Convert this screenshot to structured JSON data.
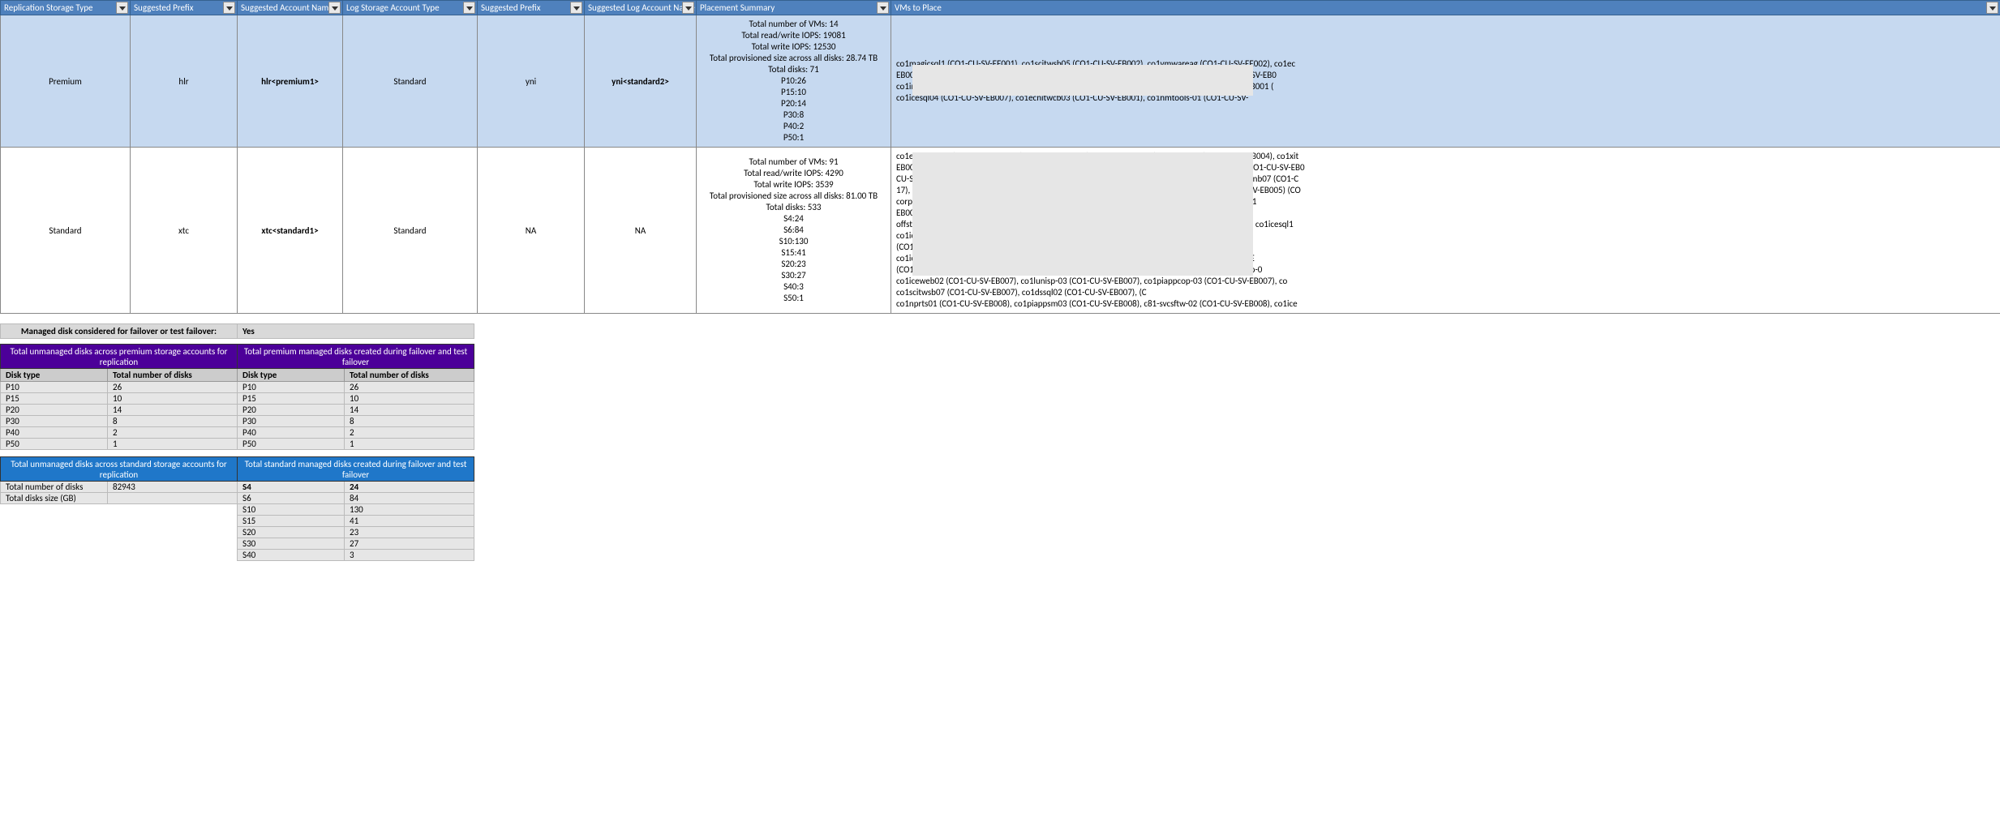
{
  "headers": {
    "c0": "Replication Storage Type",
    "c1": "Suggested Prefix",
    "c2": "Suggested Account Name",
    "c3": "Log Storage Account Type",
    "c4": "Suggested Prefix",
    "c5": "Suggested Log Account  Name",
    "c6": "Placement Summary",
    "c7": "VMs to Place"
  },
  "rows": [
    {
      "repl_type": "Premium",
      "prefix": "hlr",
      "account": "hlr<premium1>",
      "log_type": "Standard",
      "log_prefix": "yni",
      "log_account": "yni<standard2>",
      "summary": "Total number of VMs: 14\nTotal read/write IOPS: 19081\nTotal write IOPS: 12530\nTotal provisioned size across all disks: 28.74 TB\nTotal disks: 71\nP10:26\nP15:10\nP20:14\nP30:8\nP40:2\nP50:1",
      "vms": "co1magicsql1 (CO1-CU-SV-EE001), co1scitwsb05 (CO1-CU-SV-EB002), co1vmwareag (CO1-CU-SV-EE002), co1ec\nEB003), co1mpsdb01 (CO1-CU-SV-EE005), co1datamg01 (CO1-CU-SV-EB004), co1dssql01 (CO1-CU-SV-EB0\nco1intsvc02 (CO1-CU-SV-EB005), co1ecnintweb02 (CO1-CU-SV-EB007), co1lunisp-02 (CO1-CU-SV-EB001 (\nco1icesql04 (CO1-CU-SV-EB007), co1ecnitwcb03 (CO1-CU-SV-EB001), co1nmtools-01 (CO1-CU-SV-"
    },
    {
      "repl_type": "Standard",
      "prefix": "xtc",
      "account": "xtc<standard1>",
      "log_type": "Standard",
      "log_prefix": "NA",
      "log_account": "NA",
      "summary": "Total number of VMs: 91\nTotal read/write IOPS: 4290\nTotal write IOPS: 3539\nTotal provisioned size across all disks: 81.00 TB\nTotal disks: 533\nS4:24\nS6:84\nS10:130\nS15:41\nS20:23\nS30:27\nS40:3\nS50:1",
      "vms": "co1ecritwnb07 (CO1-CU-SV-EB004), co1piappcrm02 (CO1-CU-SV-EB004), co1cu1407 (CO1-CU-SV-EB004), co1xit\nEB004), co1ecnintweb02 (CO1-CU-SV-EB004), co1nmstatm-01 (CO1-CU-SV-EB004), co1intweb01 (CO1-CU-SV-EB0\nCU-SV-EB004), co1ecnitwcb03 (CO1-CU-SV-EB005), co1piappcop-01 (CO1-CU-SV-EB005), co1ecritwnb07 (CO1-C\n17), co1iceweb01 (CO1-CU-SV-EB005), co1nprts02 (CO1-CU-SV-EB005), co1piappdxp-01 (CO1-CU-SV-EB005) (CO\ncorp-02 (CO1-CU-SV-EB005), co1mpsivr03 (CO1-CU-SV-EB005), co1icesql01 (CO1-CU-SV-EB005). co1\nEB005). co1dataci01 (CO1-CU-SV-EB005), co1ecnitweb01 (CO1-CU-SV-EB005), co1sftp-01 (CO1-C\noffstg01 (CO1-CU-SV-EB005), co1ecnitecd02 (CO1-CU-SV-EB005), co1mpsivr04 (CO1-CU-SV-EB005), co1icesql1\nco1icesql03 (CO1-CU-SV-EB005), co1iceapp01 (CO1-CU-SV-EB005), co1icesql02 (CO1-CU-SV-EB006)\n(CO1-CU-SV-EB006), co1dbweb01 (CO1-CU-SV-EB006), co1scitwsb03 (CO1-CU-SV-EB006) (CO\nco1iceweb01 (CO1-CU-SV-EB006), co1iceapp02 (CO1-CU-SV-EB006), co1ecnitcem01 (CO1-CU-SV-EE\n(CO1-CU-SV-EB007), co1fp-03 (CO1-CU-SV-EB007), co1piappivr04 (CO1-CU-SV-EB007), co1piappdxp-0\nco1iceweb02 (CO1-CU-SV-EB007), co1lunisp-03 (CO1-CU-SV-EB007), co1piappcop-03 (CO1-CU-SV-EB007), co\nco1scitwsb07 (CO1-CU-SV-EB007), co1dssql02 (CO1-CU-SV-EB007), (C\nco1nprts01 (CO1-CU-SV-EB008), co1piappsm03 (CO1-CU-SV-EB008), c81-svcsftw-02 (CO1-CU-SV-EB008), co1ice"
    }
  ],
  "managed_label": "Managed disk considered for failover or test failover:",
  "managed_value": "Yes",
  "premium": {
    "left_title": "Total  unmanaged disks across premium storage accounts for replication",
    "right_title": "Total premium managed disks created during failover and test failover",
    "sub_disk": "Disk type",
    "sub_total": "Total number of disks",
    "rows": [
      {
        "k": "P10",
        "v": "26"
      },
      {
        "k": "P15",
        "v": "10"
      },
      {
        "k": "P20",
        "v": "14"
      },
      {
        "k": "P30",
        "v": "8"
      },
      {
        "k": "P40",
        "v": "2"
      },
      {
        "k": "P50",
        "v": "1"
      }
    ]
  },
  "standard": {
    "left_title": "Total unmanaged disks across standard storage accounts for replication",
    "right_title": "Total standard managed disks created during failover and test failover",
    "left_rows": [
      {
        "k": "Total number of disks",
        "v": "82943"
      },
      {
        "k": "Total disks size (GB)",
        "v": ""
      }
    ],
    "right_rows": [
      {
        "k": "S4",
        "v": "24"
      },
      {
        "k": "S6",
        "v": "84"
      },
      {
        "k": "S10",
        "v": "130"
      },
      {
        "k": "S15",
        "v": "41"
      },
      {
        "k": "S20",
        "v": "23"
      },
      {
        "k": "S30",
        "v": "27"
      },
      {
        "k": "S40",
        "v": "3"
      }
    ]
  }
}
